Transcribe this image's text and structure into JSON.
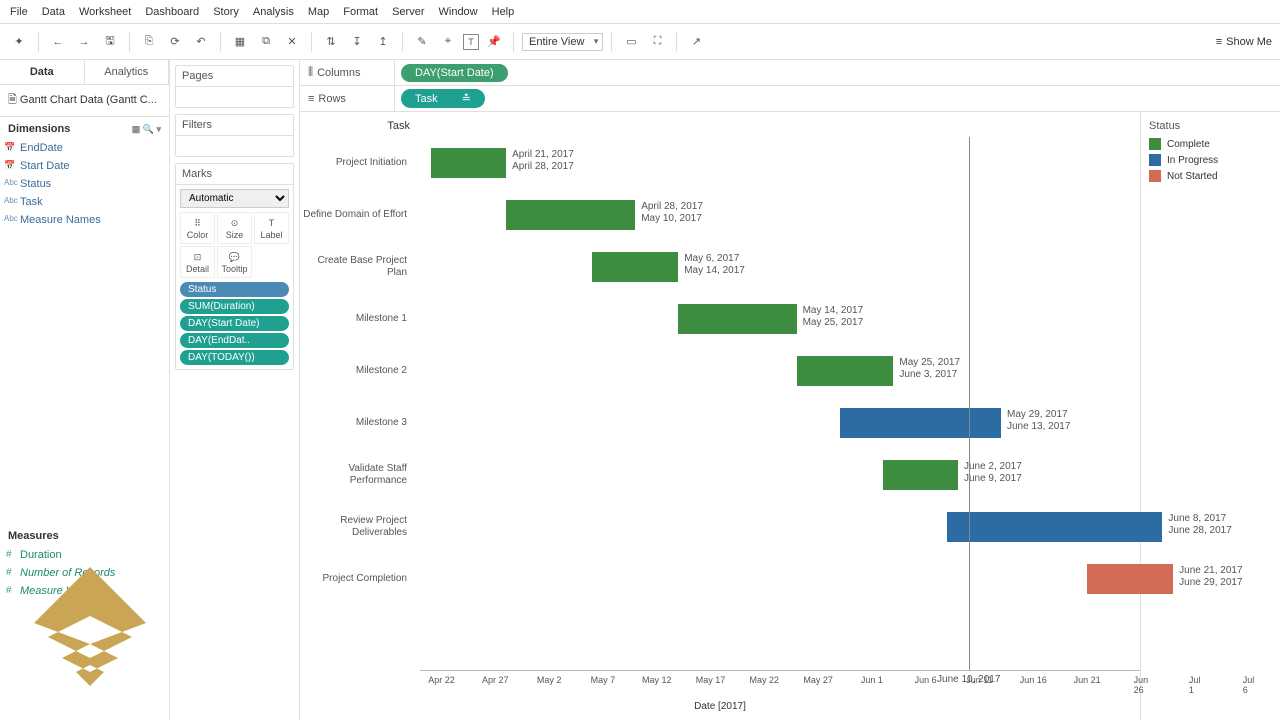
{
  "menu": [
    "File",
    "Data",
    "Worksheet",
    "Dashboard",
    "Story",
    "Analysis",
    "Map",
    "Format",
    "Server",
    "Window",
    "Help"
  ],
  "toolbar": {
    "fit": "Entire View",
    "showme": "Show Me"
  },
  "side": {
    "tabs": [
      "Data",
      "Analytics"
    ],
    "datasource": "Gantt Chart Data (Gantt C...",
    "dims_hdr": "Dimensions",
    "dims": [
      "EndDate",
      "Start Date",
      "Status",
      "Task",
      "Measure Names"
    ],
    "meas_hdr": "Measures",
    "meas": [
      "Duration",
      "Number of Records",
      "Measure Values"
    ]
  },
  "cards": {
    "pages": "Pages",
    "filters": "Filters",
    "marks": "Marks",
    "marks_type": "Automatic",
    "marks_cells": [
      "Color",
      "Size",
      "Label",
      "Detail",
      "Tooltip"
    ],
    "pills": [
      "Status",
      "SUM(Duration)",
      "DAY(Start Date)",
      "DAY(EndDat..",
      "DAY(TODAY())"
    ]
  },
  "shelves": {
    "cols": "Columns",
    "cols_pill": "DAY(Start Date)",
    "rows": "Rows",
    "rows_pill": "Task"
  },
  "chart_title": "Task",
  "legend": {
    "title": "Status",
    "items": [
      {
        "label": "Complete",
        "color": "#3d8c40"
      },
      {
        "label": "In Progress",
        "color": "#2d6ca2"
      },
      {
        "label": "Not Started",
        "color": "#d16b56"
      }
    ]
  },
  "axis": {
    "label": "Date [2017]",
    "ticks": [
      "Apr 22",
      "Apr 27",
      "May 2",
      "May 7",
      "May 12",
      "May 17",
      "May 22",
      "May 27",
      "Jun 1",
      "Jun 6",
      "Jun 11",
      "Jun 16",
      "Jun 21",
      "Jun 26",
      "Jul 1",
      "Jul 6"
    ],
    "ref_line": "June 10, 2017"
  },
  "chart_data": {
    "type": "bar",
    "title": "Task",
    "xlabel": "Date [2017]",
    "ylabel": "Task",
    "x_range": [
      "2017-04-20",
      "2017-07-08"
    ],
    "reference_line": "2017-06-10",
    "series": [
      {
        "name": "Complete",
        "color": "#3d8c40"
      },
      {
        "name": "In Progress",
        "color": "#2d6ca2"
      },
      {
        "name": "Not Started",
        "color": "#d16b56"
      }
    ],
    "tasks": [
      {
        "task": "Project Initiation",
        "start": "2017-04-21",
        "end": "2017-04-28",
        "status": "Complete",
        "label1": "April 21, 2017",
        "label2": "April 28, 2017"
      },
      {
        "task": "Define Domain of Effort",
        "start": "2017-04-28",
        "end": "2017-05-10",
        "status": "Complete",
        "label1": "April 28, 2017",
        "label2": "May 10, 2017"
      },
      {
        "task": "Create Base Project Plan",
        "start": "2017-05-06",
        "end": "2017-05-14",
        "status": "Complete",
        "label1": "May 6, 2017",
        "label2": "May 14, 2017"
      },
      {
        "task": "Milestone 1",
        "start": "2017-05-14",
        "end": "2017-05-25",
        "status": "Complete",
        "label1": "May 14, 2017",
        "label2": "May 25, 2017"
      },
      {
        "task": "Milestone 2",
        "start": "2017-05-25",
        "end": "2017-06-03",
        "status": "Complete",
        "label1": "May 25, 2017",
        "label2": "June 3, 2017"
      },
      {
        "task": "Milestone 3",
        "start": "2017-05-29",
        "end": "2017-06-13",
        "status": "In Progress",
        "label1": "May 29, 2017",
        "label2": "June 13, 2017"
      },
      {
        "task": "Validate Staff Performance",
        "start": "2017-06-02",
        "end": "2017-06-09",
        "status": "Complete",
        "label1": "June 2, 2017",
        "label2": "June 9, 2017"
      },
      {
        "task": "Review Project Deliverables",
        "start": "2017-06-08",
        "end": "2017-06-28",
        "status": "In Progress",
        "label1": "June 8, 2017",
        "label2": "June 28, 2017"
      },
      {
        "task": "Project Completion",
        "start": "2017-06-21",
        "end": "2017-06-29",
        "status": "Not Started",
        "label1": "June 21, 2017",
        "label2": "June 29, 2017"
      }
    ]
  }
}
